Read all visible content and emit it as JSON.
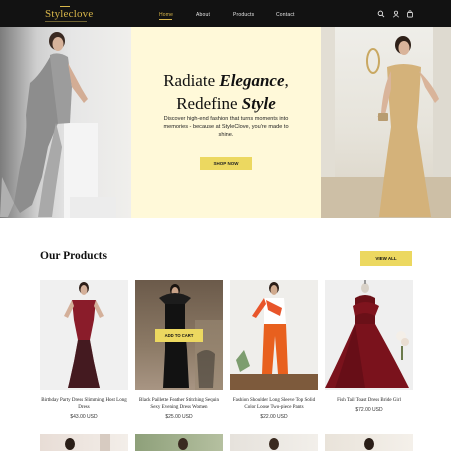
{
  "brand": {
    "name": "Styleclove"
  },
  "nav": {
    "links": [
      "Home",
      "About",
      "Products",
      "Contact"
    ],
    "icons": [
      "search-icon",
      "user-icon",
      "cart-icon"
    ],
    "accent": "#d8b64a",
    "background": "#121212"
  },
  "hero": {
    "title_line1_plain": "Radiate ",
    "title_line1_em": "Elegance",
    "title_line1_tail": ",",
    "title_line2_plain": "Redefine ",
    "title_line2_em": "Style",
    "description": "Discover high-end fashion that turns moments into memories - because at StyleClove, you're made to shine.",
    "button": "SHOP NOW",
    "background": "#fff9d9",
    "button_color": "#ecd860"
  },
  "products": {
    "title": "Our Products",
    "view_all": "VIEW ALL",
    "add_to_cart": "ADD TO CART",
    "items": [
      {
        "name": "Birthday Party Dress Slimming Host Long Dress",
        "price": "$43.00 USD"
      },
      {
        "name": "Black Paillette Feather Stitching Sequin Sexy Evening Dress Women",
        "price": "$25.00 USD"
      },
      {
        "name": "Fashion Shoulder Long Sleeve Top Solid Color Loose Two-piece Pants",
        "price": "$22.00 USD"
      },
      {
        "name": "Fish Tail Toast Dress Bride Girl",
        "price": "$72.00 USD"
      }
    ]
  }
}
